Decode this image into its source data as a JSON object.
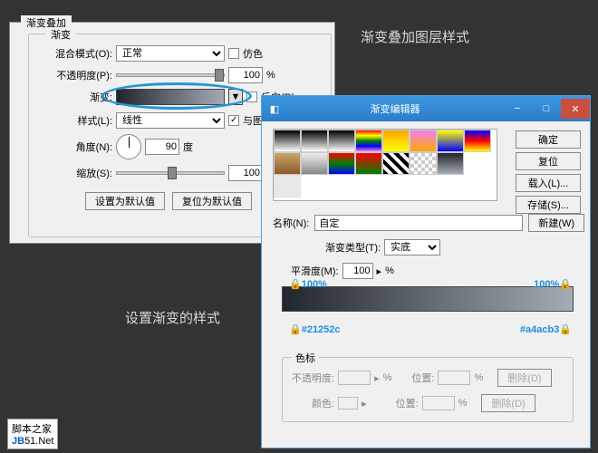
{
  "captions": {
    "top_right": "渐变叠加图层样式",
    "mid_left": "设置渐变的样式"
  },
  "logo": {
    "line1": "脚本之家",
    "line2a": "JB",
    "line2b": "51.Net"
  },
  "left": {
    "title": "渐变叠加",
    "subtitle": "渐变",
    "blend_label": "混合模式(O):",
    "blend_value": "正常",
    "dither_label": "仿色",
    "opacity_label": "不透明度(P):",
    "opacity_value": "100",
    "percent": "%",
    "gradient_label": "渐变:",
    "reverse_label": "反向(R)",
    "style_label": "样式(L):",
    "style_value": "线性",
    "align_label": "与图层对齐(I)",
    "angle_label": "角度(N):",
    "angle_value": "90",
    "degree": "度",
    "scale_label": "缩放(S):",
    "scale_value": "100",
    "set_default": "设置为默认值",
    "reset_default": "复位为默认值"
  },
  "right": {
    "title": "渐变编辑器",
    "btn_ok": "确定",
    "btn_cancel": "复位",
    "btn_load": "载入(L)...",
    "btn_save": "存储(S)...",
    "name_label": "名称(N):",
    "name_value": "自定",
    "btn_new": "新建(W)",
    "type_label": "渐变类型(T):",
    "type_value": "实底",
    "smooth_label": "平滑度(M):",
    "smooth_value": "100",
    "tri": "▸",
    "stops": {
      "left_opacity": "100%",
      "right_opacity": "100%",
      "left_color": "#21252c",
      "right_color": "#a4acb3",
      "group_title": "色标",
      "opacity_label": "不透明度:",
      "percent": "%",
      "pos_label": "位置:",
      "del_label": "删除(D)",
      "color_label": "颜色:"
    }
  }
}
